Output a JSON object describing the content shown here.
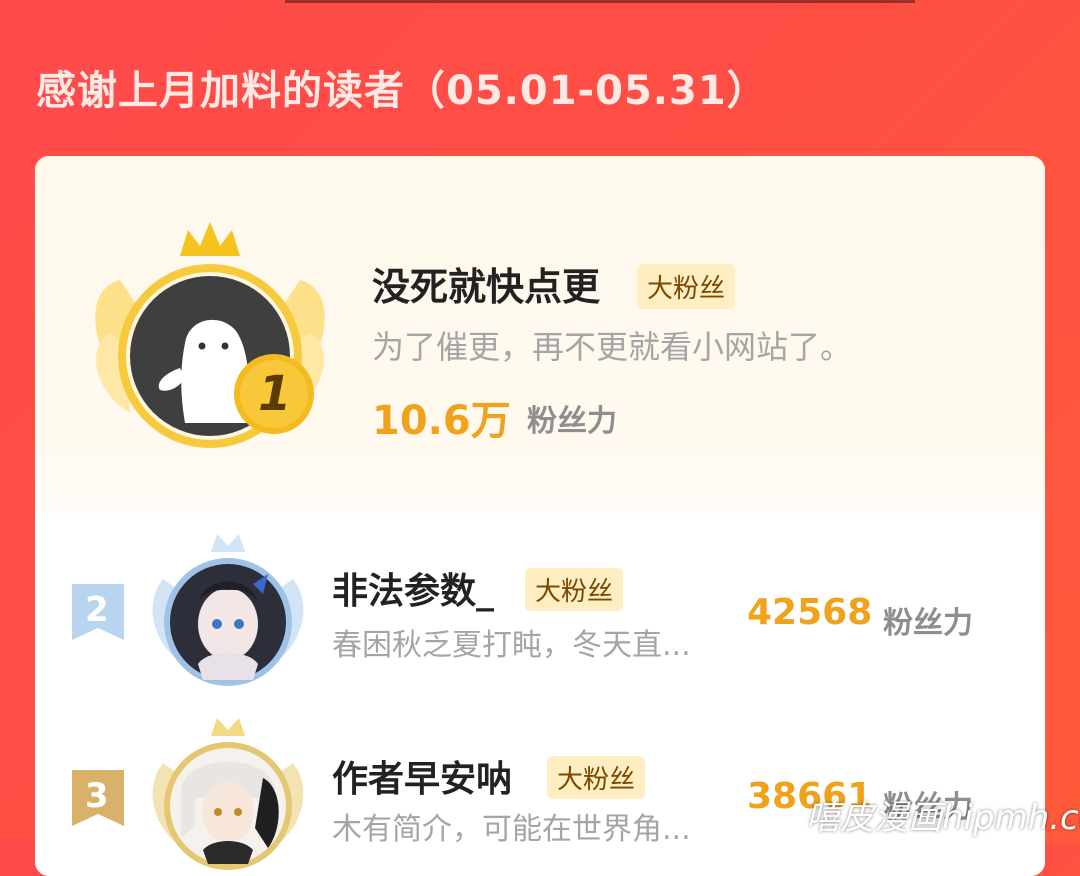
{
  "header": {
    "title": "感谢上月加料的读者（05.01-05.31）"
  },
  "top_reader": {
    "rank": "1",
    "name": "没死就快点更",
    "badge": "大粉丝",
    "description": "为了催更，再不更就看小网站了。",
    "score": "10.6万",
    "score_unit": "粉丝力"
  },
  "readers": [
    {
      "rank": "2",
      "name": "非法参数_",
      "badge": "大粉丝",
      "description": "春困秋乏夏打盹，冬天直...",
      "score": "42568",
      "score_unit": "粉丝力"
    },
    {
      "rank": "3",
      "name": "作者早安呐",
      "badge": "大粉丝",
      "description": "木有简介，可能在世界角...",
      "score": "38661",
      "score_unit": "粉丝力"
    }
  ],
  "watermark": "嘻皮漫画hipmh.com",
  "colors": {
    "accent": "#f0a21b",
    "background": "#ff4a4a",
    "badge_bg": "#ffeec1",
    "silver": "#9fc2e6",
    "gold": "#d8b26a"
  }
}
